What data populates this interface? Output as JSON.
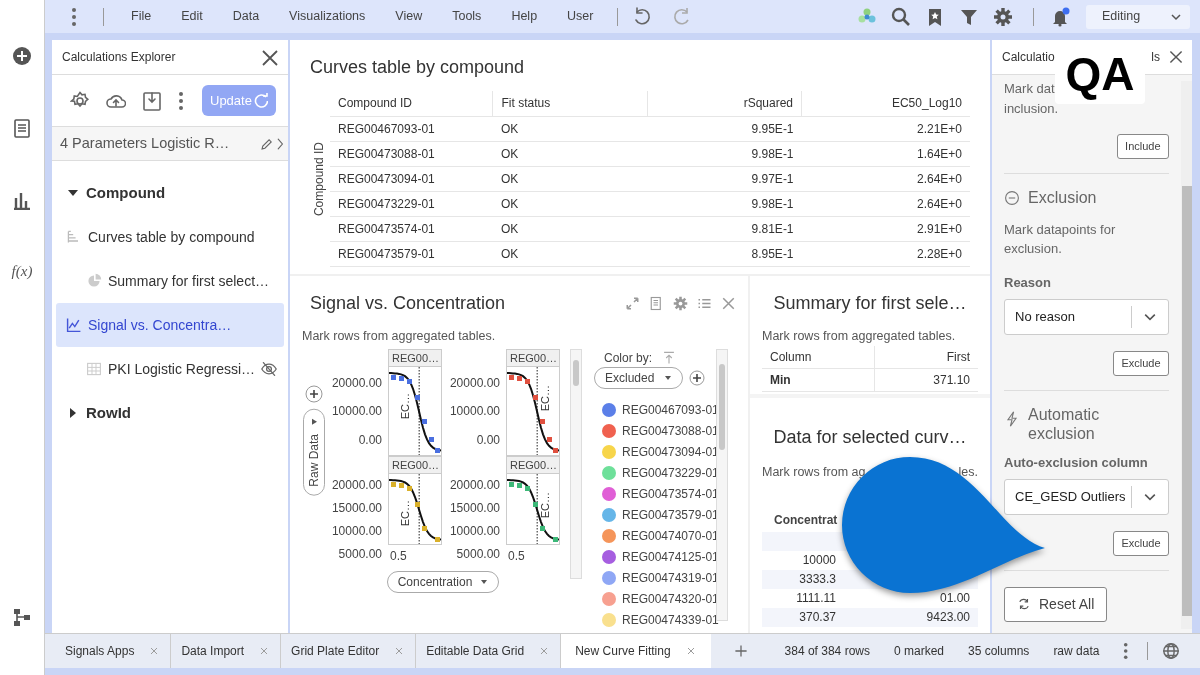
{
  "menu": {
    "items": [
      "File",
      "Edit",
      "Data",
      "Visualizations",
      "View",
      "Tools",
      "Help",
      "User"
    ],
    "mode": "Editing"
  },
  "rail": {
    "formula": "f(x)"
  },
  "explorer": {
    "title": "Calculations Explorer",
    "update_button": "Update",
    "calculation": "4 Parameters Logistic R…",
    "tree": [
      {
        "label": "Compound",
        "expanded": true,
        "children": [
          {
            "label": "Curves table by compound",
            "kind": "table",
            "selected": false,
            "hidden": false,
            "children": [
              {
                "label": "Summary for first select…",
                "kind": "pie",
                "selected": false,
                "hidden": false
              }
            ]
          },
          {
            "label": "Signal vs. Concentra…",
            "kind": "chart",
            "selected": true,
            "hidden": false,
            "children": [
              {
                "label": "PKI Logistic Regressi…",
                "kind": "grid",
                "selected": false,
                "hidden": true
              }
            ]
          }
        ]
      },
      {
        "label": "RowId",
        "expanded": false
      }
    ]
  },
  "curves_table": {
    "title": "Curves table by compound",
    "axis_label": "Compound ID",
    "columns": [
      "Compound ID",
      "Fit status",
      "rSquared",
      "EC50_Log10"
    ],
    "rows": [
      [
        "REG00467093-01",
        "OK",
        "9.95E-1",
        "2.21E+0"
      ],
      [
        "REG00473088-01",
        "OK",
        "9.98E-1",
        "1.64E+0"
      ],
      [
        "REG00473094-01",
        "OK",
        "9.97E-1",
        "2.64E+0"
      ],
      [
        "REG00473229-01",
        "OK",
        "9.98E-1",
        "2.64E+0"
      ],
      [
        "REG00473574-01",
        "OK",
        "9.81E-1",
        "2.91E+0"
      ],
      [
        "REG00473579-01",
        "OK",
        "8.95E-1",
        "2.28E+0"
      ]
    ]
  },
  "signal_chart": {
    "title": "Signal vs. Concentration",
    "note": "Mark rows from aggregated tables.",
    "y_selector": "Raw Data",
    "x_selector": "Concentration",
    "panels": [
      {
        "title": "REG00…",
        "marker": "EC…",
        "color": "#4a6fe0",
        "yticks": [
          "20000.00",
          "10000.00",
          "0.00"
        ]
      },
      {
        "title": "REG00…",
        "marker": "EC…",
        "color": "#e0503f",
        "yticks": [
          "20000.00",
          "10000.00",
          "0.00"
        ]
      },
      {
        "title": "REG00…",
        "marker": "EC…",
        "color": "#d9b02a",
        "yticks": [
          "20000.00",
          "15000.00",
          "10000.00",
          "5000.00"
        ],
        "xtick": "0.5"
      },
      {
        "title": "REG00…",
        "marker": "EC…",
        "color": "#3cb878",
        "yticks": [
          "20000.00",
          "15000.00",
          "10000.00",
          "5000.00"
        ],
        "xtick": "0.5"
      }
    ],
    "legend": {
      "label": "Color by:",
      "value": "Excluded",
      "items": [
        {
          "label": "REG00467093-01",
          "color": "#5b7fe8"
        },
        {
          "label": "REG00473088-01",
          "color": "#f0614f"
        },
        {
          "label": "REG00473094-01",
          "color": "#f7d54a"
        },
        {
          "label": "REG00473229-01",
          "color": "#6ee09a"
        },
        {
          "label": "REG00473574-01",
          "color": "#e05fd6"
        },
        {
          "label": "REG00473579-01",
          "color": "#66b6e8"
        },
        {
          "label": "REG00474070-01",
          "color": "#f5955a"
        },
        {
          "label": "REG00474125-01",
          "color": "#a65ee0"
        },
        {
          "label": "REG00474319-01",
          "color": "#8fa7f5"
        },
        {
          "label": "REG00474320-01",
          "color": "#f7a090"
        },
        {
          "label": "REG00474339-01",
          "color": "#f9e08e"
        }
      ]
    }
  },
  "summary": {
    "title": "Summary for first sele…",
    "note": "Mark rows from aggregated tables.",
    "columns": [
      "Column",
      "First"
    ],
    "rows": [
      [
        "Min",
        "371.10"
      ]
    ]
  },
  "data_table": {
    "title": "Data for selected curv…",
    "note": "Mark rows from ag",
    "note_end": "les.",
    "column": "Concentrat",
    "rows": [
      [
        "",
        ""
      ],
      [
        "10000",
        ""
      ],
      [
        "3333.3",
        ""
      ],
      [
        "1111.11",
        "01.00"
      ],
      [
        "370.37",
        "9423.00"
      ]
    ]
  },
  "tools": {
    "title_start": "Calculatio",
    "title_end": "ls",
    "inclusion": {
      "text_start": "Mark dat",
      "text_end": "inclusion.",
      "button": "Include"
    },
    "exclusion": {
      "heading": "Exclusion",
      "text": "Mark datapoints for exclusion.",
      "reason_label": "Reason",
      "reason": "No reason",
      "button": "Exclude"
    },
    "auto": {
      "heading": "Automatic exclusion",
      "column_label": "Auto-exclusion column",
      "column": "CE_GESD Outliers",
      "button": "Exclude"
    },
    "reset": "Reset All"
  },
  "overlay": {
    "badge": "QA"
  },
  "tabs": [
    {
      "label": "Signals Apps",
      "selected": false
    },
    {
      "label": "Data Import",
      "selected": false
    },
    {
      "label": "Grid Plate Editor",
      "selected": false
    },
    {
      "label": "Editable Data Grid",
      "selected": false
    },
    {
      "label": "New Curve Fitting",
      "selected": true
    }
  ],
  "status": [
    "384 of 384 rows",
    "0 marked",
    "35 columns",
    "raw data"
  ]
}
